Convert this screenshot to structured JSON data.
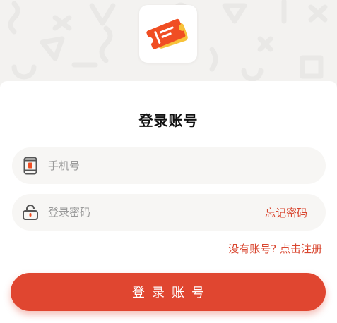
{
  "app": {
    "title": "登录账号"
  },
  "form": {
    "phone": {
      "placeholder": "手机号",
      "value": "",
      "icon": "phone-icon"
    },
    "password": {
      "placeholder": "登录密码",
      "value": "",
      "icon": "lock-icon"
    },
    "forgot_label": "忘记密码",
    "register_label": "没有账号? 点击注册",
    "submit_label": "登录账号"
  },
  "theme": {
    "accent": "#e04630",
    "logo_primary": "#f04e23",
    "logo_secondary": "#f7c23b",
    "background": "#f3f2f0"
  }
}
